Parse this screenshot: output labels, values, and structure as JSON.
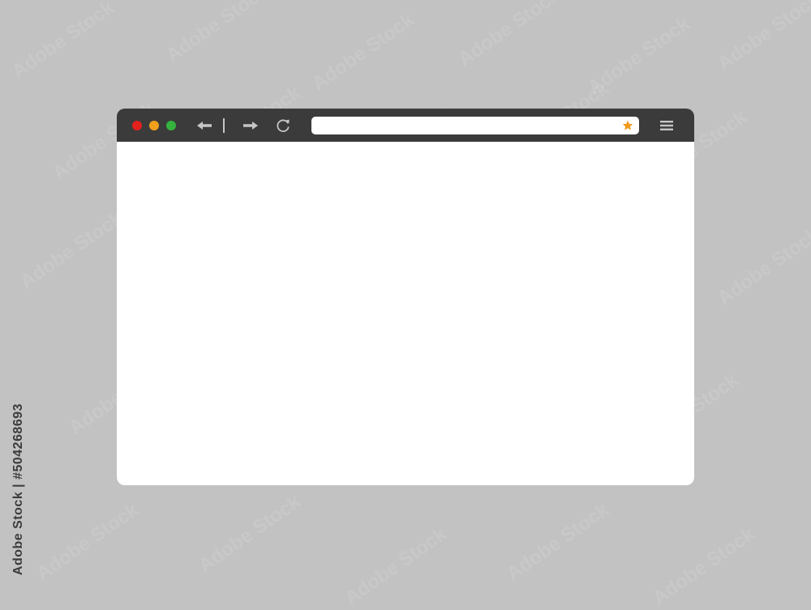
{
  "colors": {
    "background": "#c2c2c2",
    "toolbar": "#3b3b3b",
    "content": "#ffffff",
    "address_bar": "#ffffff",
    "close": "#e3211d",
    "minimize": "#f1a01b",
    "maximize": "#35b33d",
    "icon": "#c6c6c6",
    "star": "#f19a1c",
    "watermark": "#ffffff",
    "stock_id": "#3b3b3b"
  },
  "icons": {
    "close": "close-dot-icon",
    "minimize": "minimize-dot-icon",
    "maximize": "maximize-dot-icon",
    "back": "arrow-left-icon",
    "forward": "arrow-right-icon",
    "reload": "reload-icon",
    "bookmark": "star-icon",
    "menu": "hamburger-menu-icon"
  },
  "browser": {
    "address_value": "",
    "address_placeholder": ""
  },
  "watermark": {
    "text": "Adobe Stock"
  },
  "stock_id": {
    "text": "Adobe Stock | #504268693"
  }
}
